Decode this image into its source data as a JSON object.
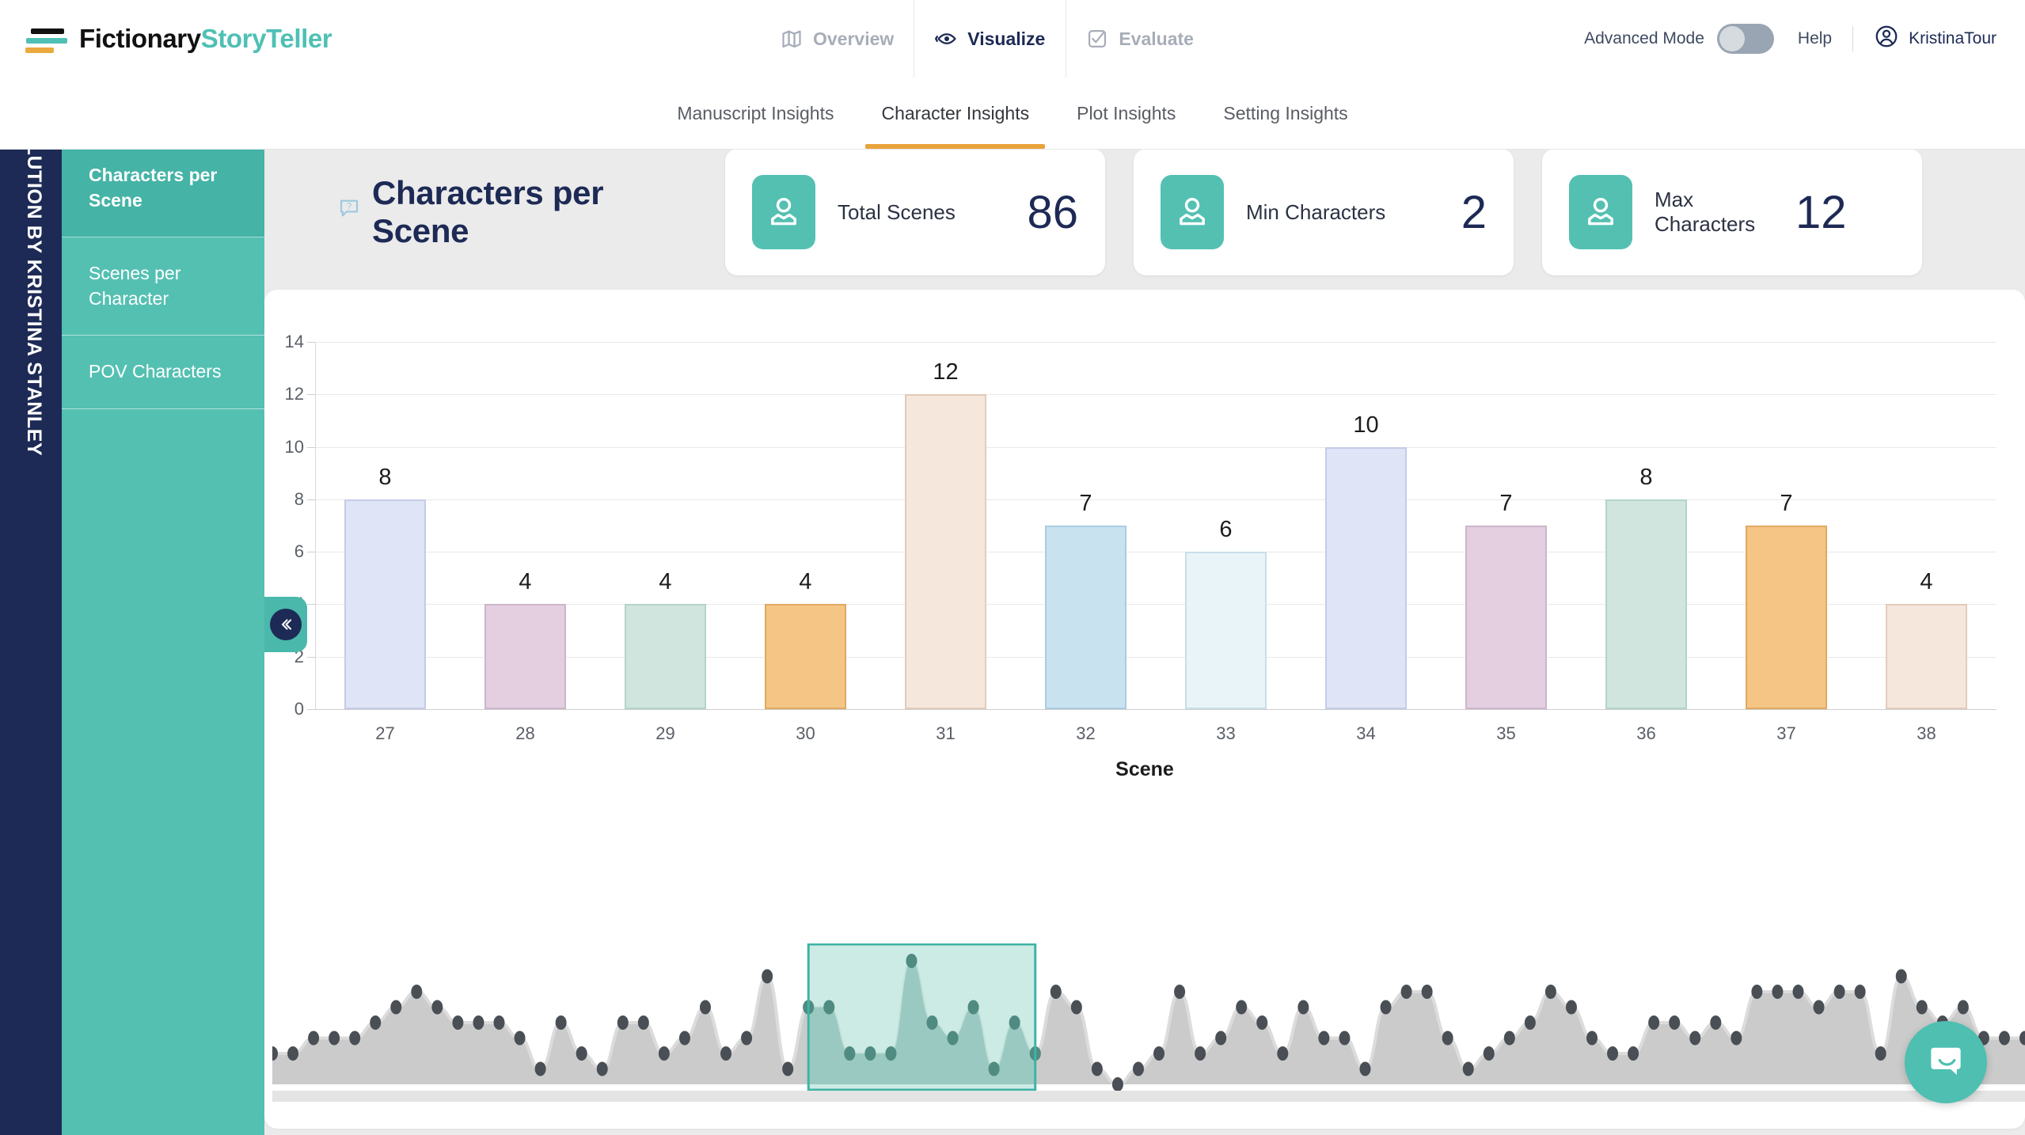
{
  "brand": {
    "name_a": "Fictionary",
    "name_b": "StoryTeller",
    "teal": "#54c0b2",
    "navy": "#1d2a55",
    "orange": "#e9a33c"
  },
  "topnav": {
    "items": [
      {
        "label": "Overview",
        "icon": "map-icon",
        "active": false
      },
      {
        "label": "Visualize",
        "icon": "eye-icon",
        "active": true
      },
      {
        "label": "Evaluate",
        "icon": "checkbox-check-icon",
        "active": false
      }
    ],
    "advanced_mode_label": "Advanced Mode",
    "advanced_mode_on": false,
    "help_label": "Help",
    "user_name": "KristinaTour"
  },
  "subtabs": [
    {
      "label": "Manuscript Insights",
      "active": false
    },
    {
      "label": "Character Insights",
      "active": true
    },
    {
      "label": "Plot Insights",
      "active": false
    },
    {
      "label": "Setting Insights",
      "active": false
    }
  ],
  "book_rail": {
    "title": "EVOLUTION BY KRISTINA STANLEY"
  },
  "sidebar": {
    "items": [
      {
        "label": "Characters per Scene",
        "active": true
      },
      {
        "label": "Scenes per Character",
        "active": false
      },
      {
        "label": "POV Characters",
        "active": false
      }
    ],
    "collapse_icon": "chevron-double-left-icon"
  },
  "page": {
    "title": "Characters per Scene",
    "help_icon": "question-bubble-icon"
  },
  "stat_cards": [
    {
      "label": "Total Scenes",
      "value": "86",
      "icon": "person-icon"
    },
    {
      "label": "Min Characters",
      "value": "2",
      "icon": "person-icon"
    },
    {
      "label": "Max Characters",
      "value": "12",
      "icon": "person-icon"
    }
  ],
  "chart_data": {
    "type": "bar",
    "title": "Characters per Scene",
    "xlabel": "Scene",
    "ylabel": "",
    "ylim": [
      0,
      14
    ],
    "yticks": [
      0,
      2,
      4,
      6,
      8,
      10,
      12,
      14
    ],
    "grid": true,
    "legend": "none",
    "categories": [
      "27",
      "28",
      "29",
      "30",
      "31",
      "32",
      "33",
      "34",
      "35",
      "36",
      "37",
      "38"
    ],
    "values": [
      8,
      4,
      4,
      4,
      12,
      7,
      6,
      10,
      7,
      8,
      7,
      4
    ],
    "bar_colors": [
      {
        "fill": "#e0e4f7",
        "stroke": "#c6cbe6"
      },
      {
        "fill": "#e3cfe0",
        "stroke": "#cdb4cb"
      },
      {
        "fill": "#cfe5dd",
        "stroke": "#b3d4c9"
      },
      {
        "fill": "#f5c585",
        "stroke": "#dfa962"
      },
      {
        "fill": "#f6e7dd",
        "stroke": "#e2cbbb"
      },
      {
        "fill": "#c9e2f0",
        "stroke": "#a9cde1"
      },
      {
        "fill": "#e8f4f8",
        "stroke": "#c8dfe7"
      },
      {
        "fill": "#e0e4f7",
        "stroke": "#c6cbe6"
      },
      {
        "fill": "#e3cfe0",
        "stroke": "#cdb4cb"
      },
      {
        "fill": "#cfe5dd",
        "stroke": "#b3d4c9"
      },
      {
        "fill": "#f5c585",
        "stroke": "#dfa962"
      },
      {
        "fill": "#f6e7dd",
        "stroke": "#e2cbbb"
      }
    ]
  },
  "brush": {
    "selection_fill": "#bfe6de",
    "selection_stroke": "#3fb3a4",
    "area_fill": "#cbcbcb",
    "dot_color": "#4a4f55",
    "selection_start_index": 26,
    "selection_end_index": 37,
    "series": [
      2,
      2,
      3,
      3,
      3,
      4,
      5,
      6,
      5,
      4,
      4,
      4,
      3,
      1,
      4,
      2,
      1,
      4,
      4,
      2,
      3,
      5,
      2,
      3,
      7,
      1,
      5,
      5,
      2,
      2,
      2,
      8,
      4,
      3,
      5,
      1,
      4,
      2,
      6,
      5,
      1,
      0,
      1,
      2,
      6,
      2,
      3,
      5,
      4,
      2,
      5,
      3,
      3,
      1,
      5,
      6,
      6,
      3,
      1,
      2,
      3,
      4,
      6,
      5,
      3,
      2,
      2,
      4,
      4,
      3,
      4,
      3,
      6,
      6,
      6,
      5,
      6,
      6,
      2,
      7,
      5,
      4,
      5,
      3,
      3,
      3
    ]
  },
  "chat": {
    "icon": "chat-bubble-icon"
  }
}
